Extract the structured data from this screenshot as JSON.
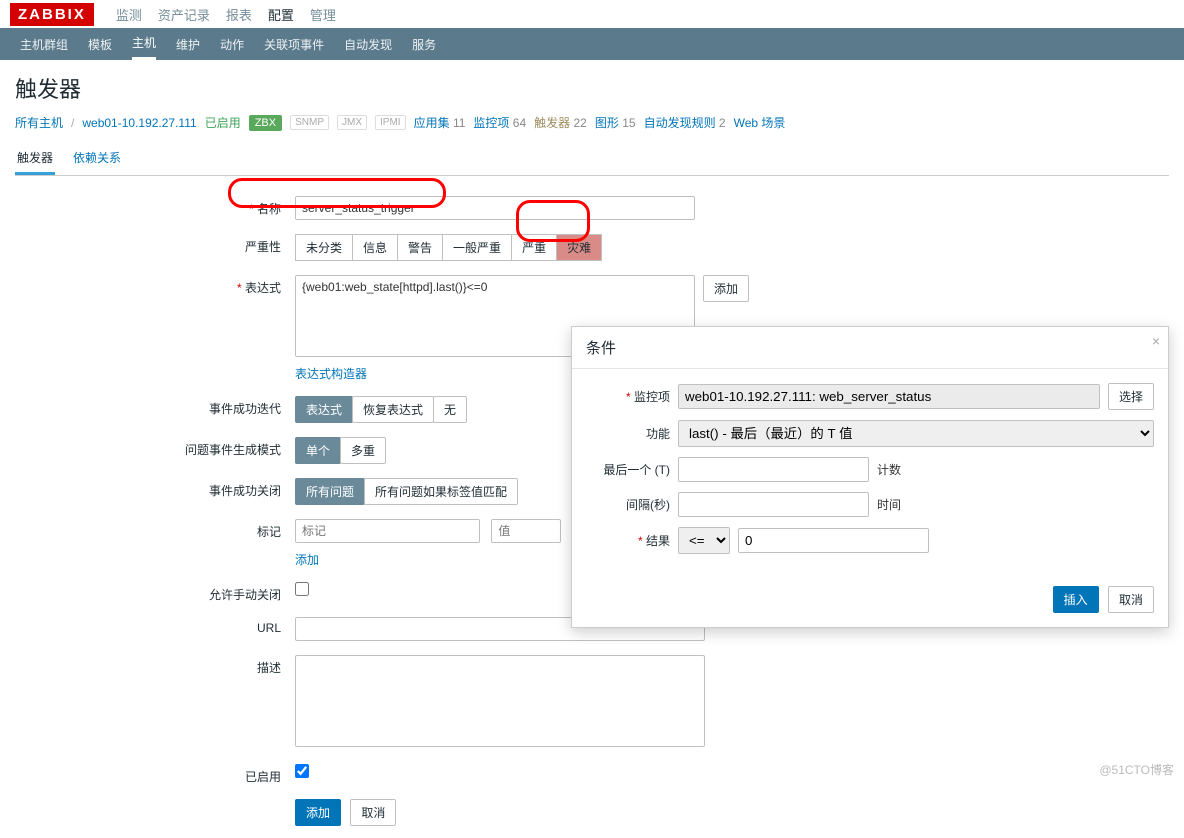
{
  "logo": "ZABBIX",
  "topnav": {
    "items": [
      "监测",
      "资产记录",
      "报表",
      "配置",
      "管理"
    ],
    "activeIndex": 3
  },
  "subnav": {
    "items": [
      "主机群组",
      "模板",
      "主机",
      "维护",
      "动作",
      "关联项事件",
      "自动发现",
      "服务"
    ],
    "activeIndex": 2
  },
  "pageTitle": "触发器",
  "breadcrumb": {
    "allHosts": "所有主机",
    "host": "web01-10.192.27.111",
    "status": "已启用",
    "zbx": "ZBX",
    "protos": [
      "SNMP",
      "JMX",
      "IPMI"
    ],
    "links": [
      {
        "l": "应用集",
        "c": "11"
      },
      {
        "l": "监控项",
        "c": "64"
      },
      {
        "l": "触发器",
        "c": "22"
      },
      {
        "l": "图形",
        "c": "15"
      },
      {
        "l": "自动发现规则",
        "c": "2"
      },
      {
        "l": "Web 场景",
        "c": ""
      }
    ],
    "activeLink": 2
  },
  "tabs": {
    "items": [
      "触发器",
      "依赖关系"
    ],
    "activeIndex": 0
  },
  "form": {
    "name": {
      "label": "名称",
      "value": "server_status_trigger"
    },
    "severity": {
      "label": "严重性",
      "options": [
        "未分类",
        "信息",
        "警告",
        "一般严重",
        "严重",
        "灾难"
      ],
      "selected": 5
    },
    "expression": {
      "label": "表达式",
      "value": "{web01:web_state[httpd].last()}<=0",
      "addBtn": "添加",
      "builder": "表达式构造器"
    },
    "okEventGen": {
      "label": "事件成功迭代",
      "options": [
        "表达式",
        "恢复表达式",
        "无"
      ],
      "selected": 0
    },
    "problemMode": {
      "label": "问题事件生成模式",
      "options": [
        "单个",
        "多重"
      ],
      "selected": 0
    },
    "okEventCloses": {
      "label": "事件成功关闭",
      "options": [
        "所有问题",
        "所有问题如果标签值匹配"
      ],
      "selected": 0
    },
    "tags": {
      "label": "标记",
      "ph1": "标记",
      "ph2": "值",
      "addBtn": "添加"
    },
    "allowManual": {
      "label": "允许手动关闭"
    },
    "url": {
      "label": "URL",
      "value": ""
    },
    "desc": {
      "label": "描述",
      "value": ""
    },
    "enabled": {
      "label": "已启用",
      "checked": true
    },
    "buttons": {
      "submit": "添加",
      "cancel": "取消"
    }
  },
  "modal": {
    "title": "条件",
    "close": "×",
    "item": {
      "label": "监控项",
      "value": "web01-10.192.27.111: web_server_status",
      "btn": "选择"
    },
    "func": {
      "label": "功能",
      "value": "last() - 最后（最近）的 T 值"
    },
    "lastT": {
      "label": "最后一个 (T)",
      "value": "",
      "unit": "计数"
    },
    "interval": {
      "label": "间隔(秒)",
      "value": "",
      "unit": "时间"
    },
    "result": {
      "label": "结果",
      "op": "<=",
      "value": "0"
    },
    "ops": [
      "=",
      "<>",
      ">",
      "<",
      ">=",
      "<="
    ],
    "buttons": {
      "insert": "插入",
      "cancel": "取消"
    }
  },
  "watermark": "@51CTO博客"
}
